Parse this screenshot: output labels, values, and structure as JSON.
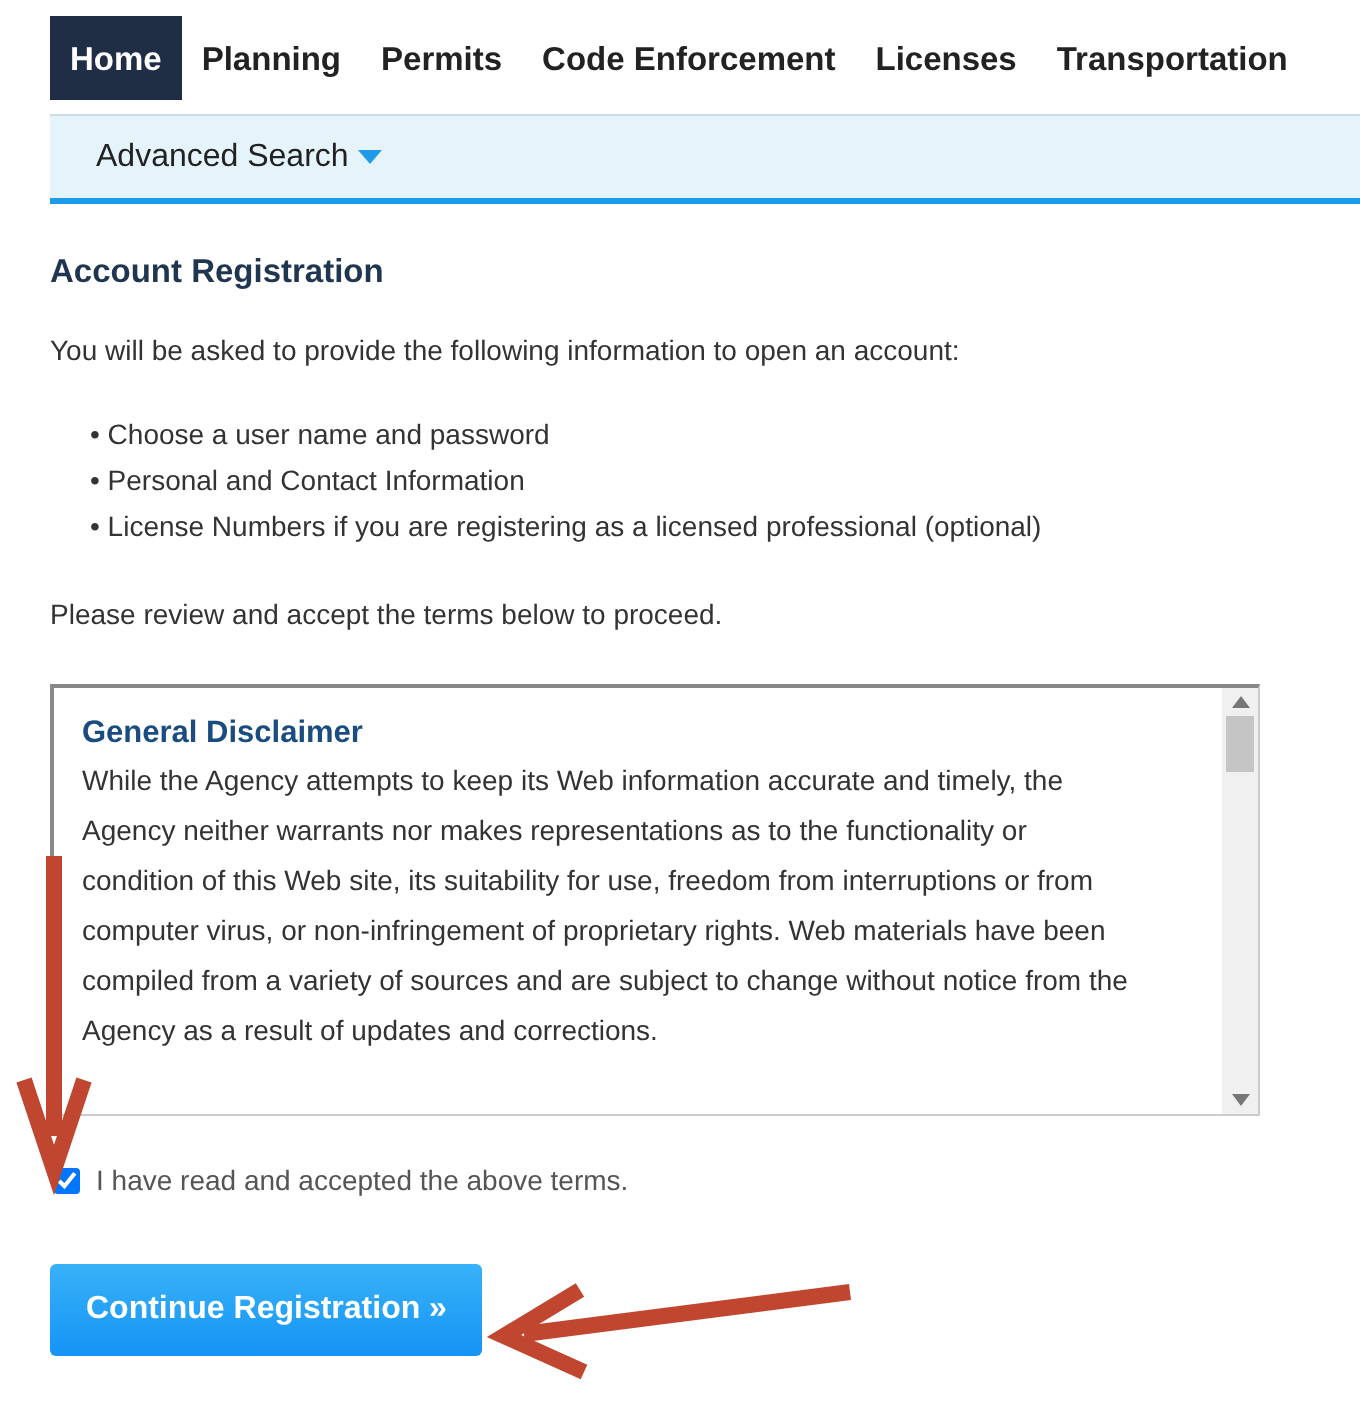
{
  "tabs": [
    {
      "label": "Home",
      "selected": true
    },
    {
      "label": "Planning",
      "selected": false
    },
    {
      "label": "Permits",
      "selected": false
    },
    {
      "label": "Code Enforcement",
      "selected": false
    },
    {
      "label": "Licenses",
      "selected": false
    },
    {
      "label": "Transportation",
      "selected": false
    }
  ],
  "subnav": {
    "label": "Advanced Search"
  },
  "heading": "Account Registration",
  "intro": "You will be asked to provide the following information to open an account:",
  "bullets": [
    "• Choose a user name and password",
    "• Personal and Contact Information",
    "• License Numbers if you are registering as a licensed professional (optional)"
  ],
  "review": "Please review and accept the terms below to proceed.",
  "terms": {
    "title": "General Disclaimer",
    "body": "While the Agency attempts to keep its Web information accurate and timely, the Agency neither warrants nor makes representations as to the functionality or condition of this Web site, its suitability for use, freedom from interruptions or from computer virus, or non-infringement of proprietary rights. Web materials have been compiled from a variety of sources and are subject to change without notice from the Agency as a result of updates and corrections."
  },
  "accept": {
    "label": "I have read and accepted the above terms.",
    "checked": true
  },
  "button": "Continue Registration »"
}
